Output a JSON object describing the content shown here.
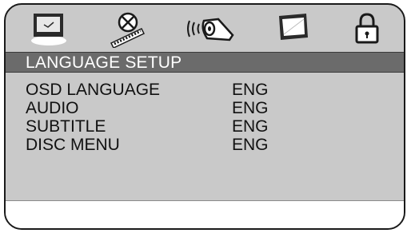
{
  "menu": {
    "tabs": [
      {
        "name": "language",
        "icon": "tv-icon",
        "selected": true
      },
      {
        "name": "video",
        "icon": "film-reel-icon",
        "selected": false
      },
      {
        "name": "audio",
        "icon": "speaker-icon",
        "selected": false
      },
      {
        "name": "preferences",
        "icon": "picture-frame-icon",
        "selected": false
      },
      {
        "name": "password",
        "icon": "padlock-icon",
        "selected": false
      }
    ],
    "title": "LANGUAGE SETUP",
    "rows": [
      {
        "label": "OSD LANGUAGE",
        "value": "ENG"
      },
      {
        "label": "AUDIO",
        "value": "ENG"
      },
      {
        "label": "SUBTITLE",
        "value": "ENG"
      },
      {
        "label": "DISC MENU",
        "value": "ENG"
      }
    ],
    "status": ""
  },
  "colors": {
    "panel_background": "#c9c9c9",
    "title_bar": "#6b6b6b",
    "text": "#111111",
    "title_text": "#ffffff"
  }
}
